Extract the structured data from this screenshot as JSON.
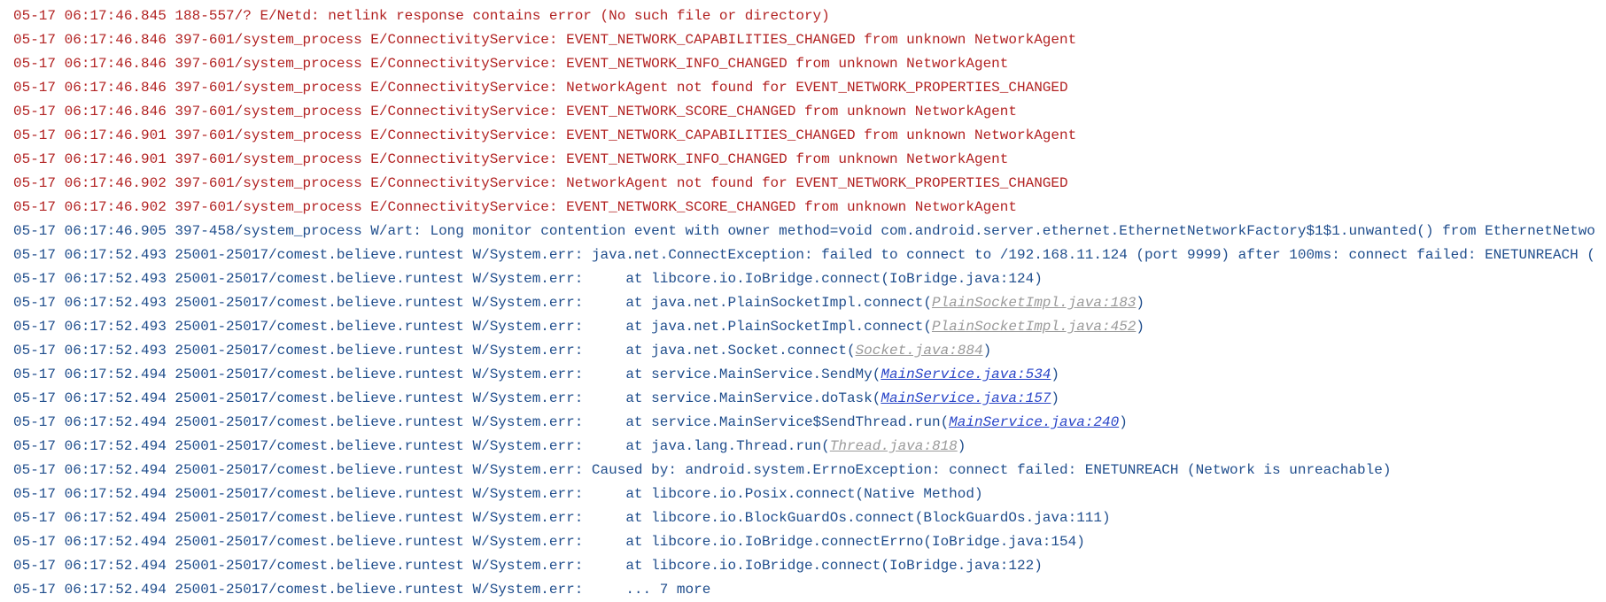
{
  "colors": {
    "error": "#b22222",
    "warning": "#1f4d8c",
    "link_local": "#2a46c8",
    "link_external": "#9a9a9a"
  },
  "lines": [
    {
      "level": "E",
      "text": "05-17 06:17:46.845 188-557/? E/Netd: netlink response contains error (No such file or directory)"
    },
    {
      "level": "E",
      "text": "05-17 06:17:46.846 397-601/system_process E/ConnectivityService: EVENT_NETWORK_CAPABILITIES_CHANGED from unknown NetworkAgent"
    },
    {
      "level": "E",
      "text": "05-17 06:17:46.846 397-601/system_process E/ConnectivityService: EVENT_NETWORK_INFO_CHANGED from unknown NetworkAgent"
    },
    {
      "level": "E",
      "text": "05-17 06:17:46.846 397-601/system_process E/ConnectivityService: NetworkAgent not found for EVENT_NETWORK_PROPERTIES_CHANGED"
    },
    {
      "level": "E",
      "text": "05-17 06:17:46.846 397-601/system_process E/ConnectivityService: EVENT_NETWORK_SCORE_CHANGED from unknown NetworkAgent"
    },
    {
      "level": "E",
      "text": "05-17 06:17:46.901 397-601/system_process E/ConnectivityService: EVENT_NETWORK_CAPABILITIES_CHANGED from unknown NetworkAgent"
    },
    {
      "level": "E",
      "text": "05-17 06:17:46.901 397-601/system_process E/ConnectivityService: EVENT_NETWORK_INFO_CHANGED from unknown NetworkAgent"
    },
    {
      "level": "E",
      "text": "05-17 06:17:46.902 397-601/system_process E/ConnectivityService: NetworkAgent not found for EVENT_NETWORK_PROPERTIES_CHANGED"
    },
    {
      "level": "E",
      "text": "05-17 06:17:46.902 397-601/system_process E/ConnectivityService: EVENT_NETWORK_SCORE_CHANGED from unknown NetworkAgent"
    },
    {
      "level": "W",
      "text": "05-17 06:17:46.905 397-458/system_process W/art: Long monitor contention event with owner method=void com.android.server.ethernet.EthernetNetworkFactory$1$1.unwanted() from EthernetNetworkFactory.java"
    },
    {
      "level": "W",
      "text": "05-17 06:17:52.493 25001-25017/comest.believe.runtest W/System.err: java.net.ConnectException: failed to connect to /192.168.11.124 (port 9999) after 100ms: connect failed: ENETUNREACH (Network is unr"
    },
    {
      "level": "W",
      "text": "05-17 06:17:52.493 25001-25017/comest.believe.runtest W/System.err:     at libcore.io.IoBridge.connect(IoBridge.java:124)"
    },
    {
      "level": "W",
      "prefix": "05-17 06:17:52.493 25001-25017/comest.believe.runtest W/System.err:     at java.net.PlainSocketImpl.connect(",
      "link": "PlainSocketImpl.java:183",
      "link_type": "external",
      "suffix": ")"
    },
    {
      "level": "W",
      "prefix": "05-17 06:17:52.493 25001-25017/comest.believe.runtest W/System.err:     at java.net.PlainSocketImpl.connect(",
      "link": "PlainSocketImpl.java:452",
      "link_type": "external",
      "suffix": ")"
    },
    {
      "level": "W",
      "prefix": "05-17 06:17:52.493 25001-25017/comest.believe.runtest W/System.err:     at java.net.Socket.connect(",
      "link": "Socket.java:884",
      "link_type": "external",
      "suffix": ")"
    },
    {
      "level": "W",
      "prefix": "05-17 06:17:52.494 25001-25017/comest.believe.runtest W/System.err:     at service.MainService.SendMy(",
      "link": "MainService.java:534",
      "link_type": "local",
      "suffix": ")"
    },
    {
      "level": "W",
      "prefix": "05-17 06:17:52.494 25001-25017/comest.believe.runtest W/System.err:     at service.MainService.doTask(",
      "link": "MainService.java:157",
      "link_type": "local",
      "suffix": ")"
    },
    {
      "level": "W",
      "prefix": "05-17 06:17:52.494 25001-25017/comest.believe.runtest W/System.err:     at service.MainService$SendThread.run(",
      "link": "MainService.java:240",
      "link_type": "local",
      "suffix": ")"
    },
    {
      "level": "W",
      "prefix": "05-17 06:17:52.494 25001-25017/comest.believe.runtest W/System.err:     at java.lang.Thread.run(",
      "link": "Thread.java:818",
      "link_type": "external",
      "suffix": ")"
    },
    {
      "level": "W",
      "text": "05-17 06:17:52.494 25001-25017/comest.believe.runtest W/System.err: Caused by: android.system.ErrnoException: connect failed: ENETUNREACH (Network is unreachable)"
    },
    {
      "level": "W",
      "text": "05-17 06:17:52.494 25001-25017/comest.believe.runtest W/System.err:     at libcore.io.Posix.connect(Native Method)"
    },
    {
      "level": "W",
      "text": "05-17 06:17:52.494 25001-25017/comest.believe.runtest W/System.err:     at libcore.io.BlockGuardOs.connect(BlockGuardOs.java:111)"
    },
    {
      "level": "W",
      "text": "05-17 06:17:52.494 25001-25017/comest.believe.runtest W/System.err:     at libcore.io.IoBridge.connectErrno(IoBridge.java:154)"
    },
    {
      "level": "W",
      "text": "05-17 06:17:52.494 25001-25017/comest.believe.runtest W/System.err:     at libcore.io.IoBridge.connect(IoBridge.java:122)"
    },
    {
      "level": "W",
      "text": "05-17 06:17:52.494 25001-25017/comest.believe.runtest W/System.err:     ... 7 more"
    }
  ]
}
